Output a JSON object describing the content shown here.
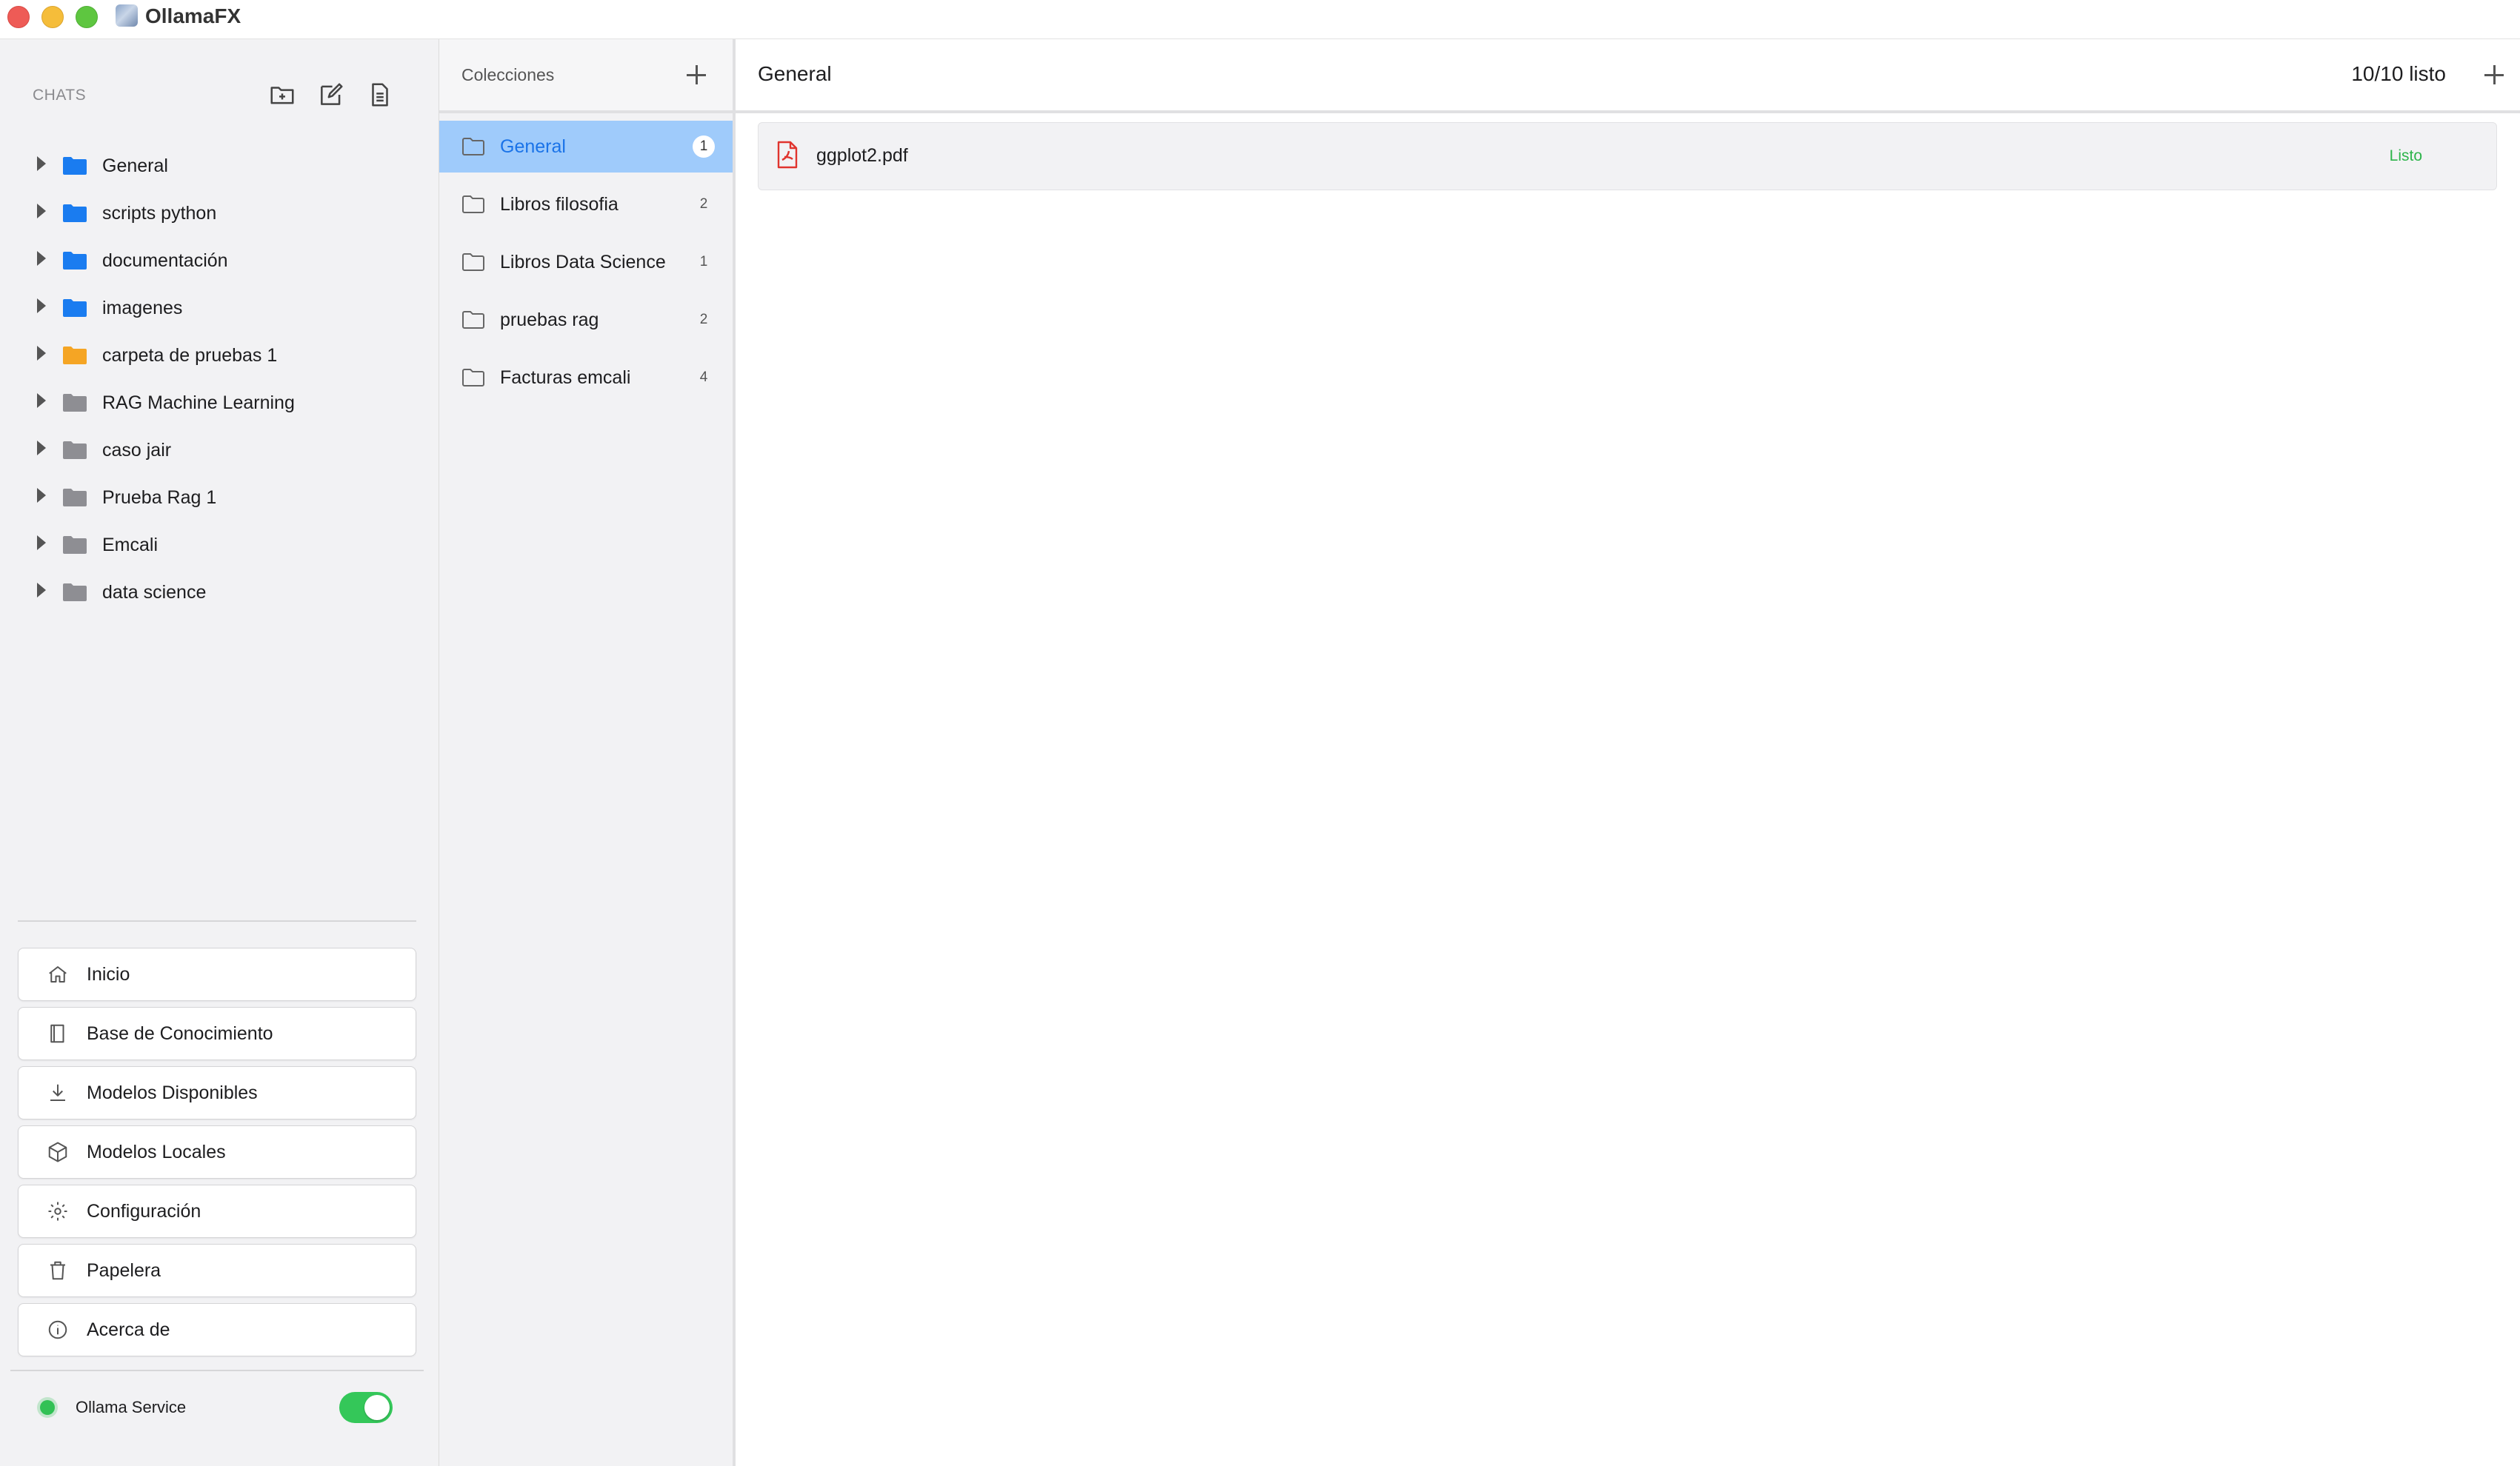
{
  "window": {
    "title": "OllamaFX"
  },
  "sidebar": {
    "header": "CHATS",
    "tree": [
      {
        "label": "General",
        "folder_color": "#1a7cf0"
      },
      {
        "label": "scripts python",
        "folder_color": "#1a7cf0"
      },
      {
        "label": "documentación",
        "folder_color": "#1a7cf0"
      },
      {
        "label": "imagenes",
        "folder_color": "#1a7cf0"
      },
      {
        "label": "carpeta de pruebas 1",
        "folder_color": "#f5a524"
      },
      {
        "label": "RAG Machine Learning",
        "folder_color": "#8e8e93"
      },
      {
        "label": "caso jair",
        "folder_color": "#8e8e93"
      },
      {
        "label": "Prueba Rag 1",
        "folder_color": "#8e8e93"
      },
      {
        "label": "Emcali",
        "folder_color": "#8e8e93"
      },
      {
        "label": "data science",
        "folder_color": "#8e8e93"
      }
    ],
    "nav": [
      {
        "label": "Inicio",
        "icon": "home-icon"
      },
      {
        "label": "Base de Conocimiento",
        "icon": "book-icon"
      },
      {
        "label": "Modelos Disponibles",
        "icon": "download-icon"
      },
      {
        "label": "Modelos Locales",
        "icon": "cube-icon"
      },
      {
        "label": "Configuración",
        "icon": "gear-icon"
      },
      {
        "label": "Papelera",
        "icon": "trash-icon"
      },
      {
        "label": "Acerca de",
        "icon": "info-icon"
      }
    ],
    "service": {
      "label": "Ollama Service",
      "enabled": true,
      "status_color": "#32c155"
    }
  },
  "collections": {
    "title": "Colecciones",
    "items": [
      {
        "label": "General",
        "count": "1",
        "active": true
      },
      {
        "label": "Libros filosofia",
        "count": "2",
        "active": false
      },
      {
        "label": "Libros Data Science",
        "count": "1",
        "active": false
      },
      {
        "label": "pruebas rag",
        "count": "2",
        "active": false
      },
      {
        "label": "Facturas emcali",
        "count": "4",
        "active": false
      }
    ]
  },
  "main": {
    "title": "General",
    "status": "10/10 listo",
    "documents": [
      {
        "name": "ggplot2.pdf",
        "status": "Listo",
        "icon": "pdf-file-icon"
      }
    ]
  },
  "colors": {
    "accent": "#1a73e8",
    "selection": "#9fcbfb",
    "success": "#2db44b"
  }
}
